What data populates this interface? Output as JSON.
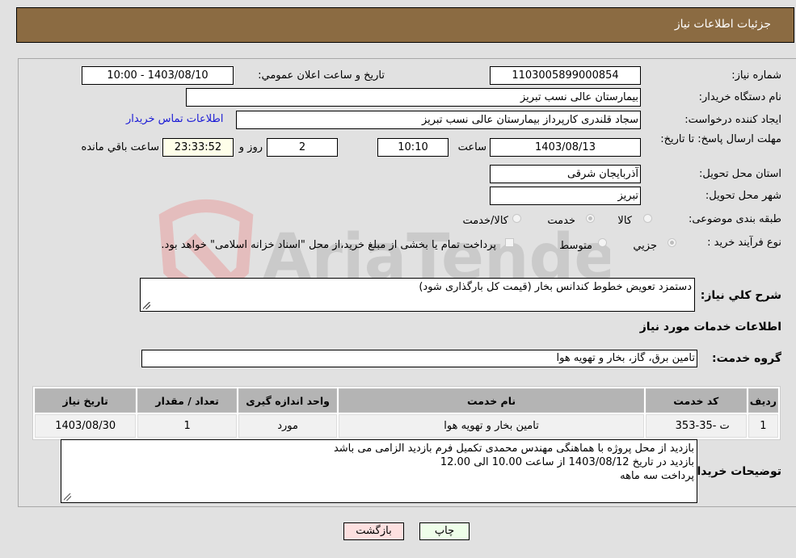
{
  "header": {
    "title": "جزئیات اطلاعات نیاز"
  },
  "form": {
    "need_number_label": "شماره نیاز:",
    "need_number": "1103005899000854",
    "announce_label": "تاریخ و ساعت اعلان عمومي:",
    "announce_value": "1403/08/10 - 10:00",
    "buyer_org_label": "نام دستگاه خریدار:",
    "buyer_org": "بیمارستان عالی نسب تبریز",
    "creator_label": "ایجاد کننده درخواست:",
    "creator": "سجاد قلندری کارپرداز بیمارستان عالی نسب تبریز",
    "contact_link": "اطلاعات تماس خریدار",
    "deadline_label": "مهلت ارسال پاسخ: تا تاریخ:",
    "deadline_date": "1403/08/13",
    "time_label": "ساعت",
    "deadline_time": "10:10",
    "days_value": "2",
    "days_label": "روز و",
    "remaining_time": "23:33:52",
    "remaining_label": "ساعت باقي مانده",
    "province_label": "استان محل تحویل:",
    "province": "آذربایجان شرقی",
    "city_label": "شهر محل تحویل:",
    "city": "تبریز",
    "category_label": "طبقه بندی موضوعی:",
    "category_options": [
      "کالا",
      "خدمت",
      "کالا/خدمت"
    ],
    "category_selected": "خدمت",
    "process_label": "نوع فرآیند خرید :",
    "process_options": [
      "جزيي",
      "متوسط"
    ],
    "process_selected": "جزيي",
    "treasury_note": "پرداخت تمام یا بخشی از مبلغ خرید،از محل \"اسناد خزانه اسلامی\" خواهد بود.",
    "description_label": "شرح کلي نياز:",
    "description": "دستمزد تعویض خطوط کندانس بخار (قیمت کل بارگذاری شود)",
    "services_heading": "اطلاعات خدمات مورد نياز",
    "service_group_label": "گروه خدمت:",
    "service_group": "تامین برق، گاز، بخار و تهویه هوا"
  },
  "table": {
    "headers": [
      "ردیف",
      "کد خدمت",
      "نام خدمت",
      "واحد اندازه گیری",
      "تعداد / مقدار",
      "تاریخ نیاز"
    ],
    "rows": [
      [
        "1",
        "ت -35-353",
        "تامین بخار و تهویه هوا",
        "مورد",
        "1",
        "1403/08/30"
      ]
    ]
  },
  "buyer_notes": {
    "label": "توضیحات خریدار:",
    "lines": [
      "بازدید از محل پروژه با هماهنگی مهندس محمدی  تکمیل فرم بازدید الزامی می باشد",
      "بازدید در تاریخ 1403/08/12 از ساعت 10.00 الی 12.00",
      "پرداخت سه ماهه"
    ]
  },
  "buttons": {
    "print": "چاپ",
    "back": "بازگشت"
  },
  "watermark": {
    "text": "AriaTender.neT"
  }
}
